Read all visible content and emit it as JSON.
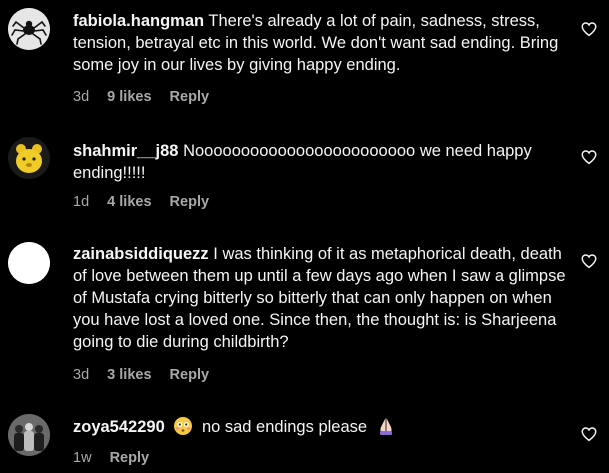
{
  "comments": [
    {
      "username": "fabiola.hangman",
      "text": "There's already a lot of pain, sadness, stress, tension, betrayal etc in this world. We don't want sad ending. Bring some joy in our lives by giving happy ending.",
      "time": "3d",
      "likes": "9 likes",
      "reply": "Reply",
      "avatar_icon": "spider-avatar"
    },
    {
      "username": "shahmir__j88",
      "text": "Noooooooooooooooooooooooo we need happy ending!!!!!",
      "time": "1d",
      "likes": "4 likes",
      "reply": "Reply",
      "avatar_icon": "yellow-bear-avatar"
    },
    {
      "username": "zainabsiddiquezz",
      "text": "I was thinking of it as metaphorical death, death of love between them up until a few days ago when I saw a glimpse of Mustafa crying bitterly so bitterly that can only happen on when you have lost a loved one. Since then, the thought is: is Sharjeena going to die during childbirth?",
      "time": "3d",
      "likes": "3 likes",
      "reply": "Reply",
      "avatar_icon": "blank-white-avatar"
    },
    {
      "username": "zoya542290",
      "text_after_emoji": "no sad endings please",
      "emoji_1": "flushed-face-emoji",
      "emoji_2": "pleading-hands-emoji",
      "time": "1w",
      "reply": "Reply",
      "avatar_icon": "group-photo-avatar"
    }
  ],
  "colors": {
    "background": "#000000",
    "primary_text": "#f5f5f5",
    "secondary_text": "#a8a8a8"
  }
}
